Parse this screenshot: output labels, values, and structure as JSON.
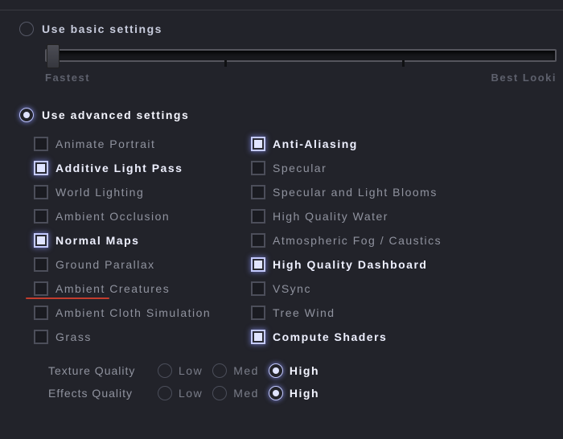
{
  "basic": {
    "label": "Use basic settings",
    "selected": false
  },
  "slider": {
    "low_label": "Fastest",
    "high_label": "Best Looki"
  },
  "advanced": {
    "label": "Use advanced settings",
    "selected": true
  },
  "options": {
    "left": [
      {
        "label": "Animate Portrait",
        "checked": false,
        "underline": false
      },
      {
        "label": "Additive Light Pass",
        "checked": true,
        "underline": false
      },
      {
        "label": "World Lighting",
        "checked": false,
        "underline": false
      },
      {
        "label": "Ambient Occlusion",
        "checked": false,
        "underline": false
      },
      {
        "label": "Normal Maps",
        "checked": true,
        "underline": false
      },
      {
        "label": "Ground Parallax",
        "checked": false,
        "underline": false
      },
      {
        "label": "Ambient Creatures",
        "checked": false,
        "underline": true
      },
      {
        "label": "Ambient Cloth Simulation",
        "checked": false,
        "underline": false
      },
      {
        "label": "Grass",
        "checked": false,
        "underline": false
      }
    ],
    "right": [
      {
        "label": "Anti-Aliasing",
        "checked": true
      },
      {
        "label": "Specular",
        "checked": false
      },
      {
        "label": "Specular and Light Blooms",
        "checked": false
      },
      {
        "label": "High Quality Water",
        "checked": false
      },
      {
        "label": "Atmospheric Fog / Caustics",
        "checked": false
      },
      {
        "label": "High Quality Dashboard",
        "checked": true
      },
      {
        "label": "VSync",
        "checked": false
      },
      {
        "label": "Tree Wind",
        "checked": false
      },
      {
        "label": "Compute Shaders",
        "checked": true
      }
    ]
  },
  "quality": [
    {
      "label": "Texture Quality",
      "options": [
        "Low",
        "Med",
        "High"
      ],
      "selected": 2
    },
    {
      "label": "Effects Quality",
      "options": [
        "Low",
        "Med",
        "High"
      ],
      "selected": 2
    }
  ]
}
